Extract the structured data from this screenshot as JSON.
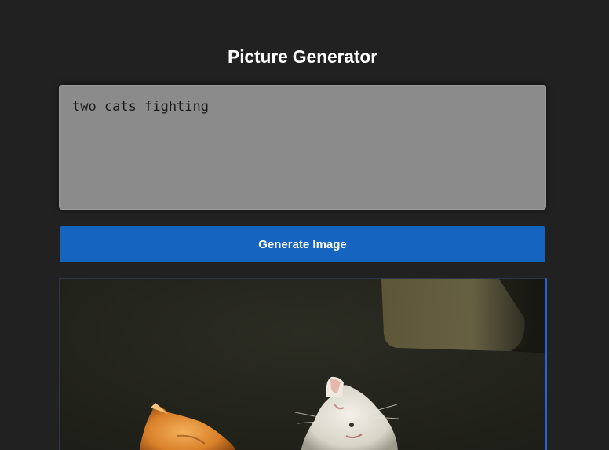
{
  "app": {
    "title": "Picture Generator"
  },
  "prompt": {
    "value": "two cats fighting"
  },
  "generate_button": {
    "label": "Generate Image"
  },
  "result_image": {
    "alt_subject": "two cats fighting",
    "colors": {
      "background": "#22231b",
      "accent_border": "#2962d6"
    }
  }
}
